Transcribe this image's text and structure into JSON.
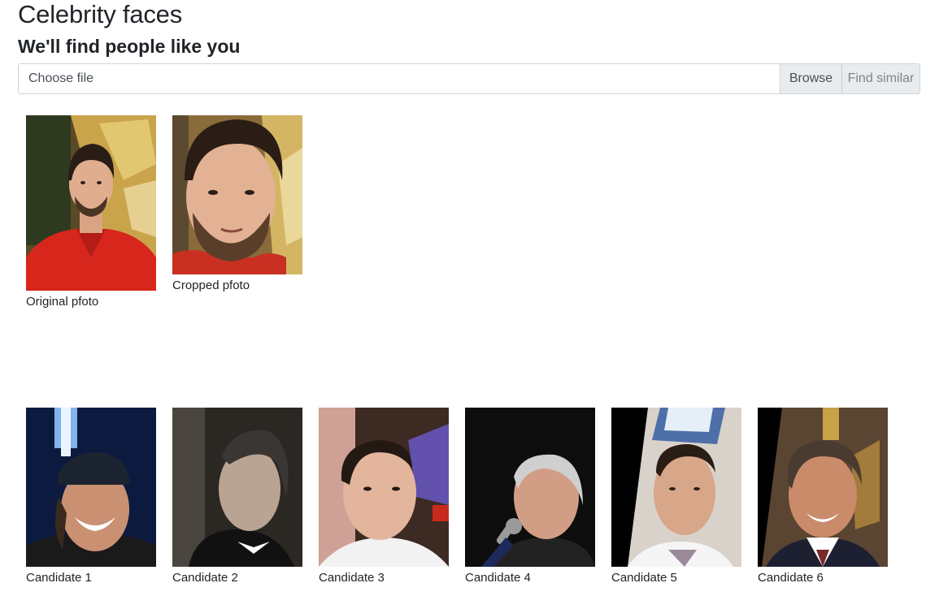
{
  "header": {
    "title": "Celebrity faces",
    "subtitle": "We'll find people like you"
  },
  "upload": {
    "file_label": "Choose file",
    "browse_label": "Browse",
    "submit_label": "Find similar"
  },
  "input_photos": [
    {
      "caption": "Original pfoto"
    },
    {
      "caption": "Cropped pfoto"
    }
  ],
  "candidates": [
    {
      "caption": "Candidate 1"
    },
    {
      "caption": "Candidate 2"
    },
    {
      "caption": "Candidate 3"
    },
    {
      "caption": "Candidate 4"
    },
    {
      "caption": "Candidate 5"
    },
    {
      "caption": "Candidate 6"
    }
  ]
}
